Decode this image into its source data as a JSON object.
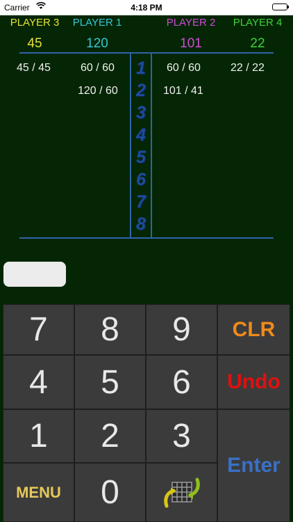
{
  "status_bar": {
    "carrier": "Carrier",
    "time": "4:18 PM"
  },
  "players": [
    {
      "name": "PLAYER 3",
      "score": "45",
      "color": "#e6e236"
    },
    {
      "name": "PLAYER 1",
      "score": "120",
      "color": "#33c7d6"
    },
    {
      "name": "PLAYER 2",
      "score": "101",
      "color": "#d24ad8"
    },
    {
      "name": "PLAYER 4",
      "score": "22",
      "color": "#3fd23b"
    }
  ],
  "rounds": [
    "1",
    "2",
    "3",
    "4",
    "5",
    "6",
    "7",
    "8"
  ],
  "entries": {
    "player3": [
      "45 /  45"
    ],
    "player1": [
      "60 /  60",
      "120 /  60"
    ],
    "player2": [
      "60 /  60",
      "101 /  41"
    ],
    "player4": [
      "22 /  22"
    ]
  },
  "input": {
    "value": ""
  },
  "keypad": {
    "keys": [
      "7",
      "8",
      "9",
      "4",
      "5",
      "6",
      "1",
      "2",
      "3",
      "0"
    ],
    "clr": "CLR",
    "undo": "Undo",
    "enter": "Enter",
    "menu": "MENU"
  },
  "colors": {
    "clr": "#f08a1c",
    "undo": "#e01010",
    "enter": "#3a70c6",
    "menu": "#e6c85a",
    "lines": "#2f63a8"
  }
}
